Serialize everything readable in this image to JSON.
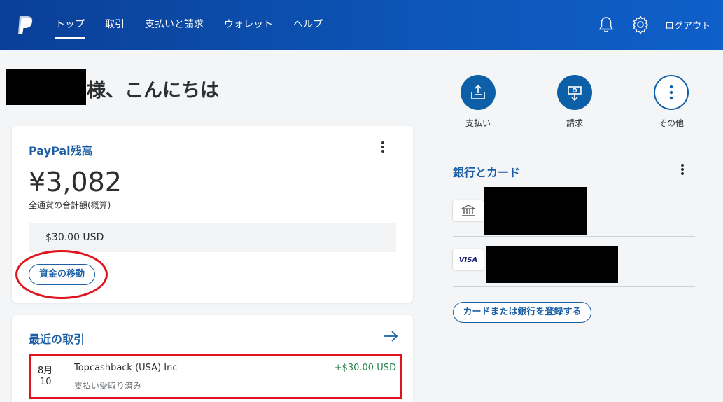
{
  "nav": {
    "items": [
      {
        "label": "トップ",
        "active": true
      },
      {
        "label": "取引",
        "active": false
      },
      {
        "label": "支払いと請求",
        "active": false
      },
      {
        "label": "ウォレット",
        "active": false
      },
      {
        "label": "ヘルプ",
        "active": false
      }
    ],
    "logout_label": "ログアウト",
    "icons": {
      "logo": "paypal-logo",
      "bell": "bell-icon",
      "settings": "gear-icon"
    }
  },
  "greeting": {
    "text": "様、こんにちは"
  },
  "balance": {
    "title": "PayPal残高",
    "amount": "¥3,082",
    "note": "全通貨の合計額(概算)",
    "currency_line": "$30.00 USD",
    "move_button": "資金の移動"
  },
  "recent": {
    "title": "最近の取引",
    "transactions": [
      {
        "month": "8月",
        "day": "10",
        "name": "Topcashback (USA) Inc",
        "status": "支払い受取り済み",
        "amount": "+$30.00 USD"
      }
    ]
  },
  "quick_actions": [
    {
      "label": "支払い",
      "icon": "send-money-icon"
    },
    {
      "label": "請求",
      "icon": "request-money-icon"
    },
    {
      "label": "その他",
      "icon": "more-icon"
    }
  ],
  "bank": {
    "title": "銀行とカード",
    "accounts": [
      {
        "type": "bank",
        "icon": "bank-icon"
      },
      {
        "type": "card",
        "brand_label": "VISA"
      }
    ],
    "register_button": "カードまたは銀行を登録する"
  },
  "colors": {
    "header": "#0d56b8",
    "accent": "#1b5fa5",
    "positive": "#2b8550",
    "annotation_red": "#e0141e"
  }
}
